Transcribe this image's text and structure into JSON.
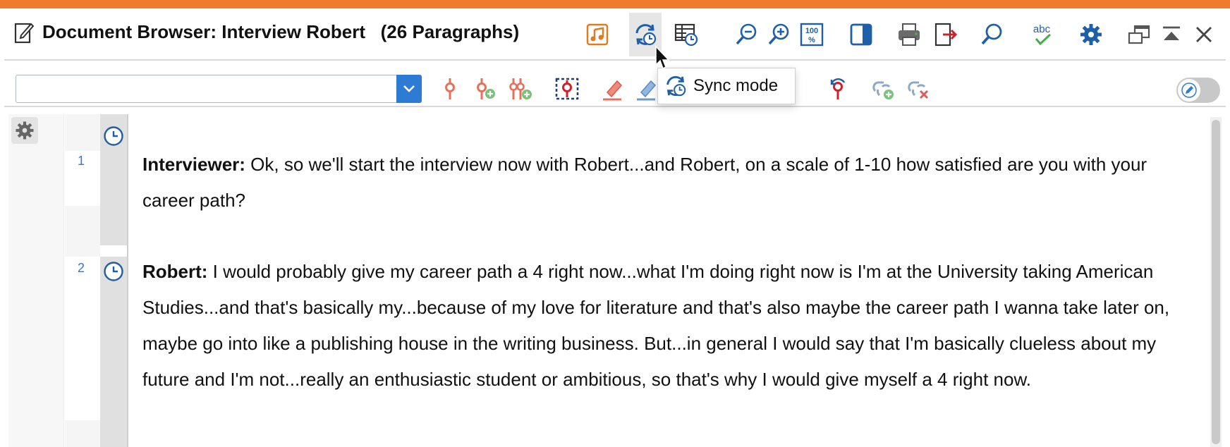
{
  "window": {
    "title": "Document Browser: Interview Robert   (26 Paragraphs)",
    "accent_color": "#f07a2e"
  },
  "toolbar": {
    "icons": [
      "media-icon",
      "sync-mode-icon",
      "table-sync-icon",
      "zoom-out-icon",
      "zoom-in-icon",
      "zoom-100-icon",
      "panel-icon",
      "print-icon",
      "export-icon",
      "search-icon",
      "spellcheck-icon",
      "settings-icon",
      "undock-icon",
      "collapse-icon",
      "close-icon"
    ],
    "spellcheck_label": "abc"
  },
  "coding_toolbar": {
    "code_selector": {
      "value": "",
      "placeholder": ""
    },
    "icons": [
      "code-icon",
      "code-add-icon",
      "code-multi-add-icon",
      "code-selection-icon",
      "highlighter-red-icon",
      "highlighter-blue-icon",
      "code-undo-icon",
      "link-add-icon",
      "link-remove-icon"
    ],
    "edit_toggle": {
      "state": "off"
    }
  },
  "tooltip": {
    "text": "Sync mode"
  },
  "paragraphs": [
    {
      "number": "1",
      "speaker": "Interviewer:",
      "text": " Ok, so we'll start the interview now with Robert...and Robert, on a scale of 1-10 how satisfied are you with your career path?"
    },
    {
      "number": "2",
      "speaker": "Robert:",
      "text": " I would probably give my career path a 4 right now...what I'm doing right now is I'm at the University taking American Studies...and that's basically my...because of my love for literature and that's also maybe the career path I wanna take later on, maybe go into like a publishing house in the writing business. But...in general I would say that I'm basically clueless about my future and I'm not...really an enthusiastic student or ambitious, so that's why I would give myself a 4 right now."
    }
  ]
}
